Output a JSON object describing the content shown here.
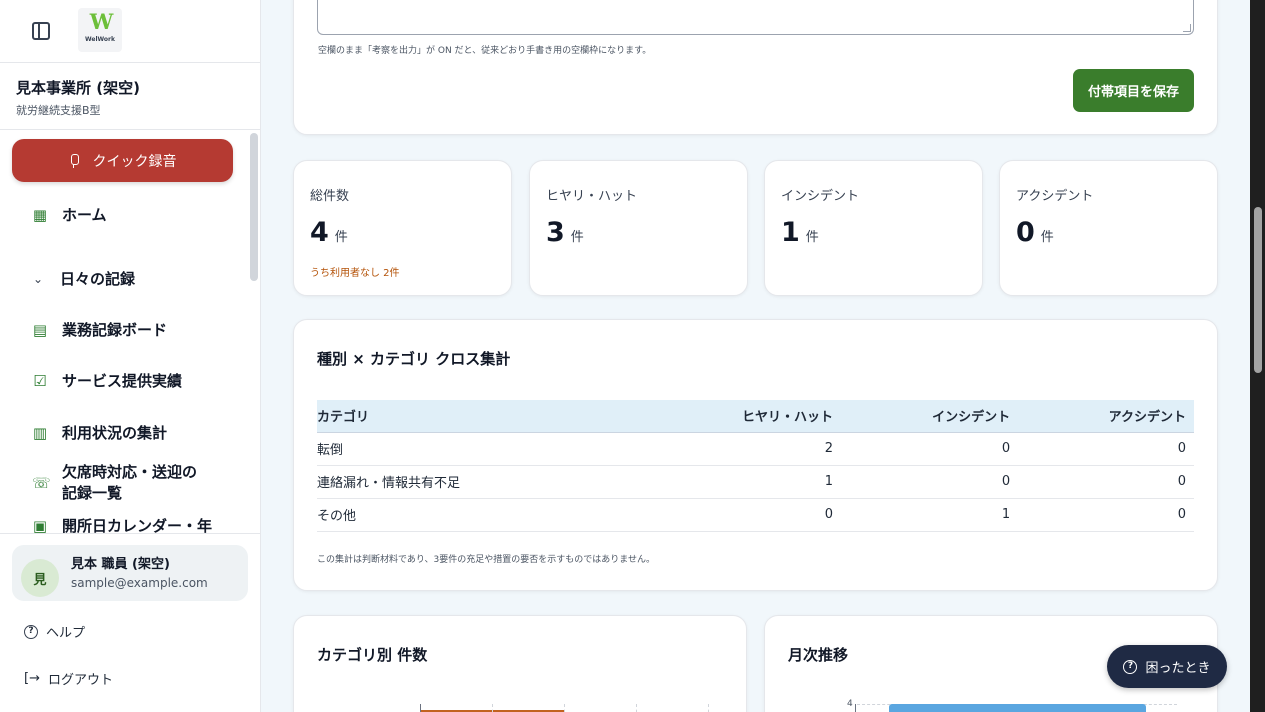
{
  "sidebar": {
    "logo_text": "WelWork",
    "org_name": "見本事業所 (架空)",
    "org_type": "就労継続支援B型",
    "quick_record": "クイック録音",
    "items": [
      {
        "label": "ホーム",
        "icon": "grid-icon"
      },
      {
        "label": "日々の記録",
        "icon": "chevron-down-icon"
      },
      {
        "label": "業務記録ボード",
        "icon": "clipboard-icon"
      },
      {
        "label": "サービス提供実績",
        "icon": "clipboard-check-icon"
      },
      {
        "label": "利用状況の集計",
        "icon": "bar-chart-icon"
      },
      {
        "label": "欠席時対応・送迎の記録一覧",
        "icon": "phone-icon"
      },
      {
        "label": "開所日カレンダー・年",
        "icon": "calendar-icon"
      }
    ],
    "user": {
      "initial": "見",
      "name": "見本 職員 (架空)",
      "email": "sample@example.com"
    },
    "help": "ヘルプ",
    "logout": "ログアウト"
  },
  "top_card": {
    "note": "空欄のまま「考察を出力」が ON だと、従来どおり手書き用の空欄枠になります。",
    "save_button": "付帯項目を保存"
  },
  "stats": [
    {
      "label": "総件数",
      "value": "4",
      "unit": "件",
      "sub": "うち利用者なし 2件"
    },
    {
      "label": "ヒヤリ・ハット",
      "value": "3",
      "unit": "件"
    },
    {
      "label": "インシデント",
      "value": "1",
      "unit": "件"
    },
    {
      "label": "アクシデント",
      "value": "0",
      "unit": "件"
    }
  ],
  "cross_table": {
    "title": "種別 × カテゴリ クロス集計",
    "headers": [
      "カテゴリ",
      "ヒヤリ・ハット",
      "インシデント",
      "アクシデント"
    ],
    "rows": [
      [
        "転倒",
        "2",
        "0",
        "0"
      ],
      [
        "連絡漏れ・情報共有不足",
        "1",
        "0",
        "0"
      ],
      [
        "その他",
        "0",
        "1",
        "0"
      ]
    ],
    "note": "この集計は判断材料であり、3要件の充足や措置の要否を示すものではありません。"
  },
  "charts": {
    "category_title": "カテゴリ別 件数",
    "monthly_title": "月次推移",
    "monthly_tick": "4"
  },
  "help_float": "困ったとき",
  "colors": {
    "accent_red": "#b53a32",
    "accent_green": "#3a7d2c",
    "navy": "#1f2a44",
    "warning_orange": "#b45309"
  }
}
